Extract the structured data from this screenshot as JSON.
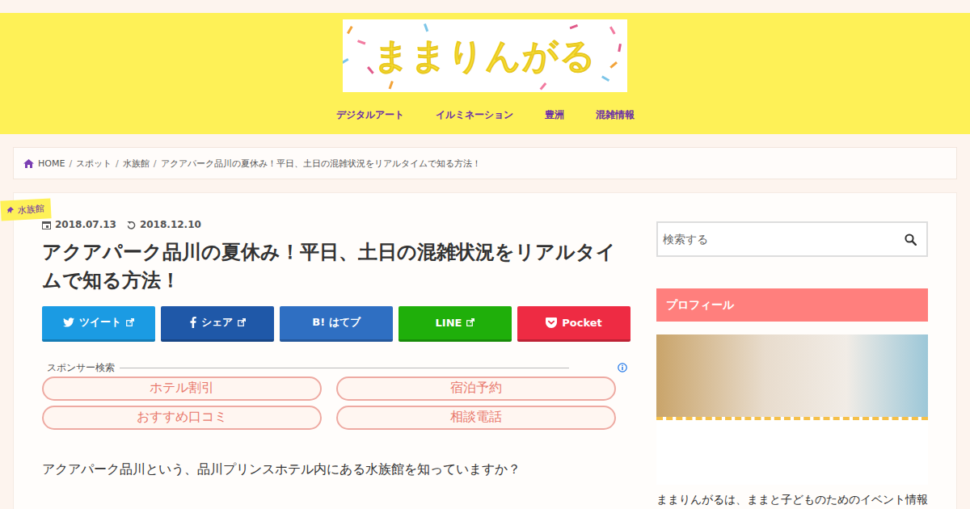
{
  "site": {
    "logo": "ままりんがる"
  },
  "nav": [
    "デジタルアート",
    "イルミネーション",
    "豊洲",
    "混雑情報"
  ],
  "breadcrumb": {
    "separator": "/",
    "items": [
      "HOME",
      "スポット",
      "水族館",
      "アクアパーク品川の夏休み！平日、土日の混雑状況をリアルタイムで知る方法！"
    ]
  },
  "article": {
    "category": "水族館",
    "published": "2018.07.13",
    "updated": "2018.12.10",
    "title": "アクアパーク品川の夏休み！平日、土日の混雑状況をリアルタイムで知る方法！",
    "share": [
      {
        "label": "ツイート",
        "kind": "twitter",
        "external": true,
        "color": "#1b9be3"
      },
      {
        "label": "シェア",
        "kind": "facebook",
        "external": true,
        "color": "#1f58a8"
      },
      {
        "label": "B! はてブ",
        "kind": "plain",
        "external": false,
        "color": "#2f6fc2"
      },
      {
        "label": "LINE",
        "kind": "plain",
        "external": true,
        "color": "#1faf0a"
      },
      {
        "label": "Pocket",
        "kind": "pocket",
        "external": false,
        "color": "#ee2b43"
      }
    ],
    "sponsor": {
      "label": "スポンサー検索",
      "links": [
        "ホテル割引",
        "宿泊予約",
        "おすすめ口コミ",
        "相談電話"
      ]
    },
    "paragraph": "アクアパーク品川という、品川プリンスホテル内にある水族館を知っていますか？"
  },
  "sidebar": {
    "search": {
      "placeholder": "検索する"
    },
    "profile": {
      "heading": "プロフィール",
      "text": "ままりんがるは、ままと子どものためのイベント情報"
    }
  }
}
